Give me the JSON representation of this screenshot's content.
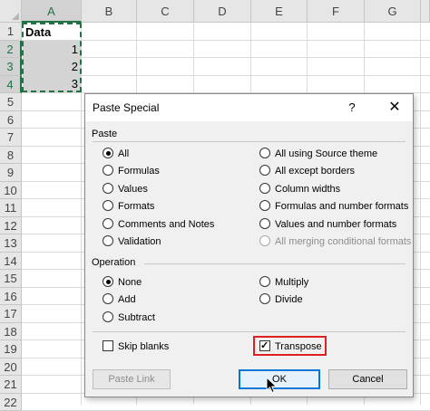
{
  "sheet": {
    "columns": [
      "A",
      "B",
      "C",
      "D",
      "E",
      "F",
      "G"
    ],
    "rows": [
      "1",
      "2",
      "3",
      "4",
      "5",
      "6",
      "7",
      "8",
      "9",
      "10",
      "11",
      "12",
      "13",
      "14",
      "15",
      "16",
      "17",
      "18",
      "19",
      "20",
      "21",
      "22"
    ],
    "cells": {
      "a1": "Data",
      "a2": "1",
      "a3": "2",
      "a4": "3"
    }
  },
  "dialog": {
    "title": "Paste Special",
    "help": "?",
    "close": "✕",
    "paste_section": "Paste",
    "paste_left": [
      "All",
      "Formulas",
      "Values",
      "Formats",
      "Comments and Notes",
      "Validation"
    ],
    "paste_right": [
      "All using Source theme",
      "All except borders",
      "Column widths",
      "Formulas and number formats",
      "Values and number formats",
      "All merging conditional formats"
    ],
    "operation_section": "Operation",
    "operation_left": [
      "None",
      "Add",
      "Subtract"
    ],
    "operation_right": [
      "Multiply",
      "Divide"
    ],
    "skip_blanks": "Skip blanks",
    "transpose": "Transpose",
    "paste_link": "Paste Link",
    "ok": "OK",
    "cancel": "Cancel"
  },
  "state": {
    "paste_selected": "All",
    "operation_selected": "None",
    "skip_blanks_checked": false,
    "transpose_checked": true
  },
  "colors": {
    "accent": "#217346",
    "highlight": "#e02020",
    "default_button": "#0078d7"
  }
}
